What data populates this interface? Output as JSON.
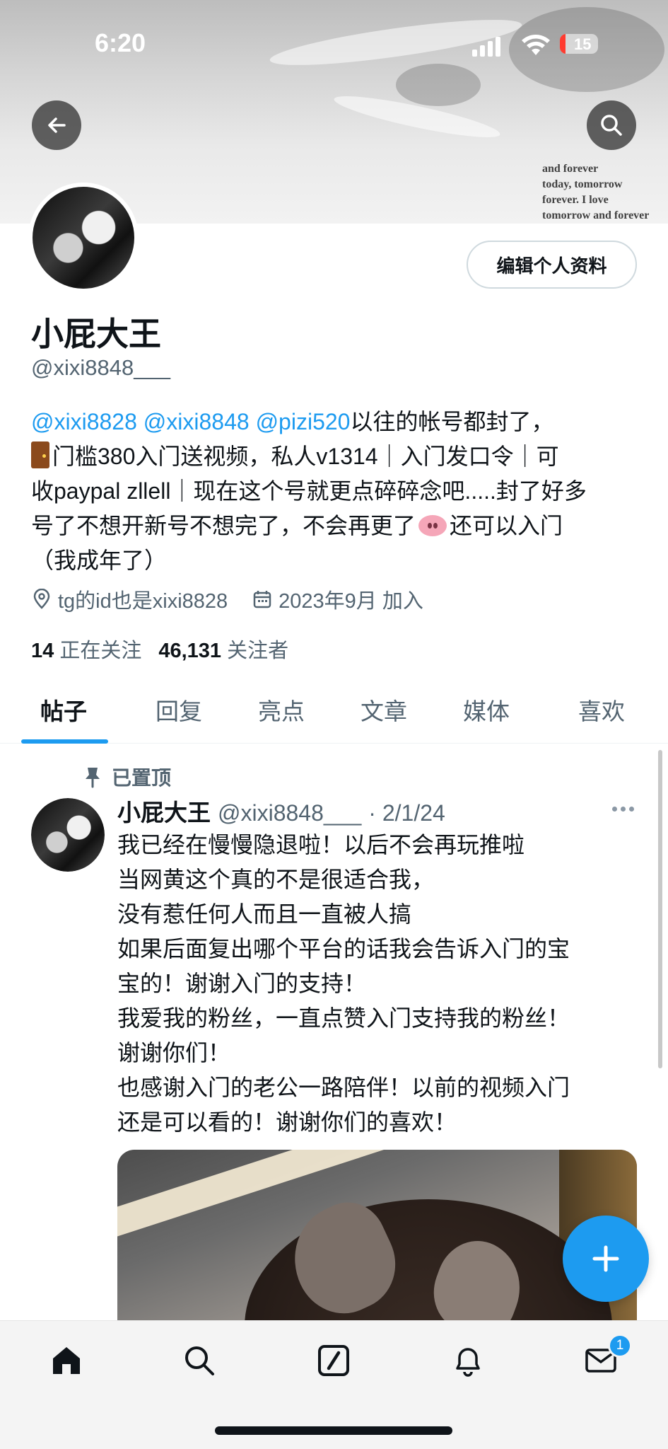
{
  "status_bar": {
    "time": "6:20",
    "battery": "15",
    "battery_level": 0.15
  },
  "banner": {
    "text": [
      "and forever",
      "today, tomorrow",
      "forever. I love",
      "tomorrow and forever"
    ]
  },
  "header": {
    "back_icon": "arrow-left-icon",
    "search_icon": "search-icon"
  },
  "profile": {
    "edit_button": "编辑个人资料",
    "name": "小屁大王",
    "handle": "@xixi8848___",
    "bio": {
      "mentions": [
        "@xixi8828",
        "@xixi8848",
        "@pizi520"
      ],
      "line1_rest": "以往的帐号都封了，",
      "line2": "门槛380入门送视频，私人v1314｜入门发口令｜可",
      "line3": "收paypal zllell｜现在这个号就更点碎碎念吧.....封了好多",
      "line4_a": "号了不想开新号不想完了，不会再更了",
      "line4_b": "还可以入门",
      "line5": "（我成年了）"
    },
    "location": "tg的id也是xixi8828",
    "joined": "2023年9月 加入",
    "following_count": "14",
    "following_label": "正在关注",
    "followers_count": "46,131",
    "followers_label": "关注者"
  },
  "tabs": [
    "帖子",
    "回复",
    "亮点",
    "文章",
    "媒体",
    "喜欢"
  ],
  "active_tab": "帖子",
  "tweet": {
    "pinned_label": "已置顶",
    "name": "小屁大王",
    "handle": "@xixi8848___",
    "date": "· 2/1/24",
    "lines": [
      "我已经在慢慢隐退啦！以后不会再玩推啦",
      "当网黄这个真的不是很适合我，",
      "没有惹任何人而且一直被人搞",
      "如果后面复出哪个平台的话我会告诉入门的宝",
      "宝的！谢谢入门的支持！",
      "我爱我的粉丝，一直点赞入门支持我的粉丝！",
      "谢谢你们！",
      "也感谢入门的老公一路陪伴！以前的视频入门",
      "还是可以看的！谢谢你们的喜欢！"
    ]
  },
  "fab_icon": "plus-icon",
  "bottom_nav": {
    "items": [
      "home-icon",
      "search-icon",
      "compose-icon",
      "bell-icon",
      "mail-icon"
    ],
    "mail_badge": "1"
  },
  "colors": {
    "accent": "#1d9bf0",
    "text": "#0f1419",
    "secondary": "#536471"
  }
}
